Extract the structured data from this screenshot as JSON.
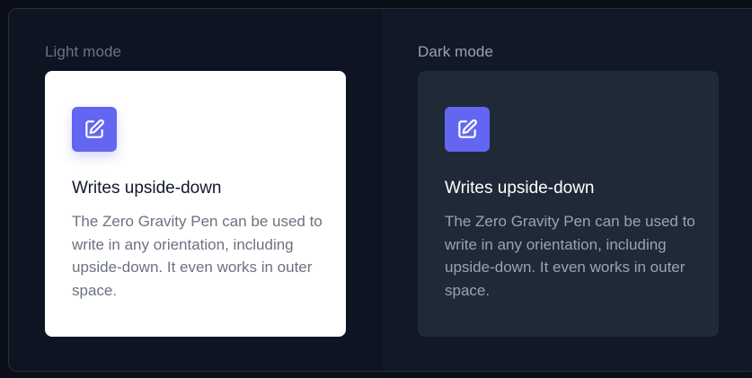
{
  "light_panel": {
    "label": "Light mode",
    "card": {
      "icon": "pencil-square-icon",
      "title": "Writes upside-down",
      "description": "The Zero Gravity Pen can be used to write in any orientation, including upside-down. It even works in outer space."
    }
  },
  "dark_panel": {
    "label": "Dark mode",
    "card": {
      "icon": "pencil-square-icon",
      "title": "Writes upside-down",
      "description": "The Zero Gravity Pen can be used to write in any orientation, including upside-down. It even works in outer space."
    }
  },
  "colors": {
    "accent": "#6366f1",
    "light_card_bg": "#ffffff",
    "dark_card_bg": "#1f2937",
    "page_bg": "#0f1422"
  }
}
